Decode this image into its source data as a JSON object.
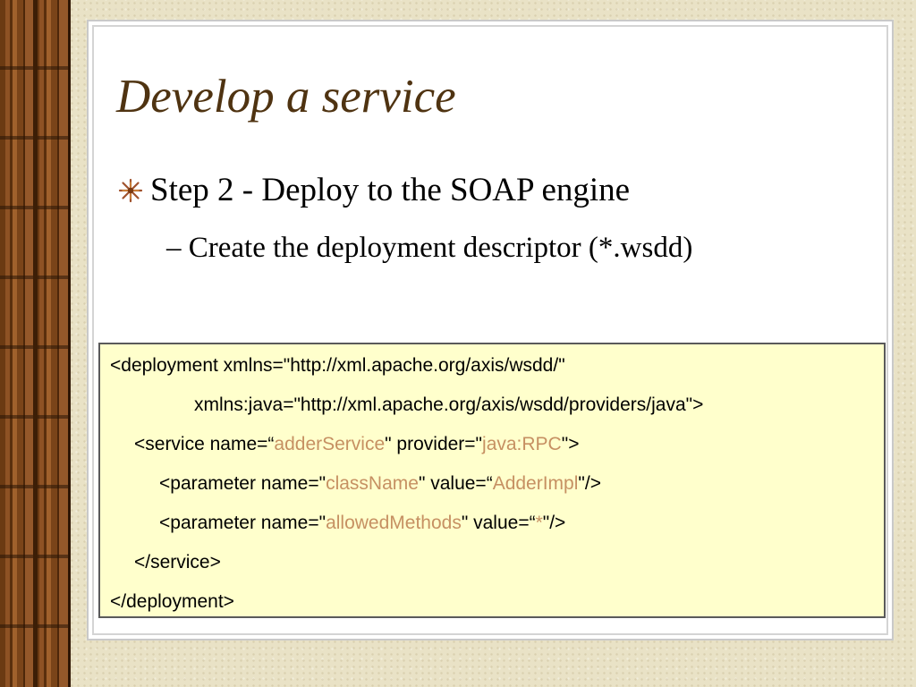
{
  "slide": {
    "title": "Develop a service",
    "bullet": "Step 2 - Deploy to the SOAP engine",
    "sub_bullet": "– Create the deployment descriptor (*.wsdd)"
  },
  "colors": {
    "title": "#4f3311",
    "highlight": "#c69062",
    "code_background": "#ffffcc"
  },
  "icons": {
    "bullet": "starburst-bullet-icon"
  },
  "code": {
    "line1": "<deployment xmlns=\"http://xml.apache.org/axis/wsdd/\"",
    "line2": "xmlns:java=\"http://xml.apache.org/axis/wsdd/providers/java\">",
    "line3": {
      "a": "<service name=“",
      "b": "adderService",
      "c": "\" provider=\"",
      "d": "java:RPC",
      "e": "\">"
    },
    "line4": {
      "a": "<parameter name=\"",
      "b": "className",
      "c": "\" value=“",
      "d": "AdderImpl",
      "e": "\"/>"
    },
    "line5": {
      "a": "<parameter name=\"",
      "b": "allowedMethods",
      "c": "\" value=“",
      "d": "*",
      "e": "\"/>"
    },
    "line6": "</service>",
    "line7": "</deployment>"
  }
}
